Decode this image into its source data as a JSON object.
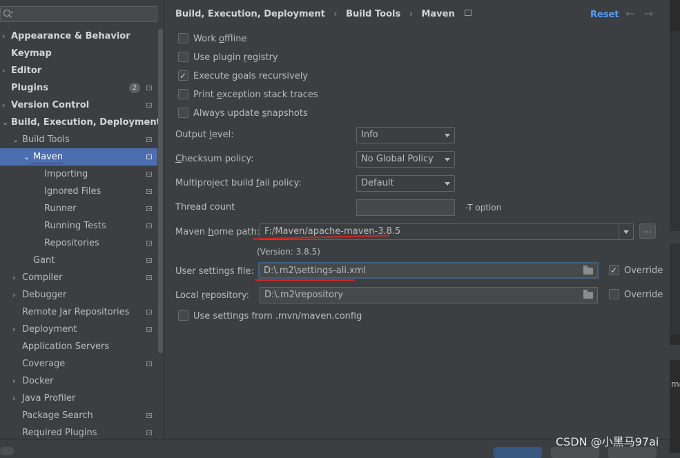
{
  "sidebar": {
    "search_placeholder": "",
    "badge_count": "2",
    "items": [
      {
        "label": "Appearance & Behavior",
        "arrow": "›"
      },
      {
        "label": "Keymap",
        "arrow": ""
      },
      {
        "label": "Editor",
        "arrow": "›"
      },
      {
        "label": "Plugins",
        "arrow": ""
      },
      {
        "label": "Version Control",
        "arrow": "›"
      },
      {
        "label": "Build, Execution, Deployment",
        "arrow": "⌄"
      },
      {
        "label": "Build Tools",
        "arrow": "⌄"
      },
      {
        "label": "Maven",
        "arrow": "⌄"
      },
      {
        "label": "Importing",
        "arrow": ""
      },
      {
        "label": "Ignored Files",
        "arrow": ""
      },
      {
        "label": "Runner",
        "arrow": ""
      },
      {
        "label": "Running Tests",
        "arrow": ""
      },
      {
        "label": "Repositories",
        "arrow": ""
      },
      {
        "label": "Gant",
        "arrow": ""
      },
      {
        "label": "Compiler",
        "arrow": "›"
      },
      {
        "label": "Debugger",
        "arrow": "›"
      },
      {
        "label": "Remote Jar Repositories",
        "arrow": ""
      },
      {
        "label": "Deployment",
        "arrow": "›"
      },
      {
        "label": "Application Servers",
        "arrow": ""
      },
      {
        "label": "Coverage",
        "arrow": ""
      },
      {
        "label": "Docker",
        "arrow": "›"
      },
      {
        "label": "Java Profiler",
        "arrow": "›"
      },
      {
        "label": "Package Search",
        "arrow": ""
      },
      {
        "label": "Required Plugins",
        "arrow": ""
      }
    ]
  },
  "header": {
    "breadcrumb": [
      "Build, Execution, Deployment",
      "Build Tools",
      "Maven"
    ],
    "separator": "›",
    "reset": "Reset",
    "back_arrow": "←",
    "forward_arrow": "→"
  },
  "options": {
    "work_offline": {
      "pre": "Work ",
      "u": "o",
      "post": "ffline",
      "checked": false
    },
    "use_plugin_registry": {
      "pre": "Use plugin ",
      "u": "r",
      "post": "egistry",
      "checked": false
    },
    "execute_goals": {
      "pre": "Execute ",
      "u": "g",
      "post": "oals recursively",
      "checked": true
    },
    "print_exception": {
      "pre": "Print ",
      "u": "e",
      "post": "xception stack traces",
      "checked": false
    },
    "always_update": {
      "pre": "Always update ",
      "u": "s",
      "post": "napshots",
      "checked": false
    }
  },
  "form": {
    "output_level": {
      "pre": "Output ",
      "u": "l",
      "post": "evel:",
      "value": "Info"
    },
    "checksum_policy": {
      "pre": "",
      "u": "C",
      "post": "hecksum policy:",
      "value": "No Global Policy"
    },
    "multiproject": {
      "pre": "Multiproject build ",
      "u": "f",
      "post": "ail policy:",
      "value": "Default"
    },
    "thread_count": {
      "label": "Thread count",
      "value": "",
      "hint": "-T option"
    },
    "maven_home": {
      "pre": "Maven ",
      "u": "h",
      "post": "ome path:",
      "value": "F:/Maven/apache-maven-3.8.5",
      "browse": "...",
      "version": "(Version: 3.8.5)"
    },
    "user_settings": {
      "label": "User settings file:",
      "value": "D:\\.m2\\settings-ali.xml",
      "override_label": "Override",
      "override_checked": true
    },
    "local_repo": {
      "pre": "Local ",
      "u": "r",
      "post": "epository:",
      "value": "D:\\.m2\\repository",
      "override_label": "Override",
      "override_checked": false
    },
    "mvn_config": {
      "label": "Use settings from .mvn/maven.config",
      "checked": false
    }
  },
  "right_strip_text": "mo",
  "watermark": "CSDN @小黑马97ai"
}
